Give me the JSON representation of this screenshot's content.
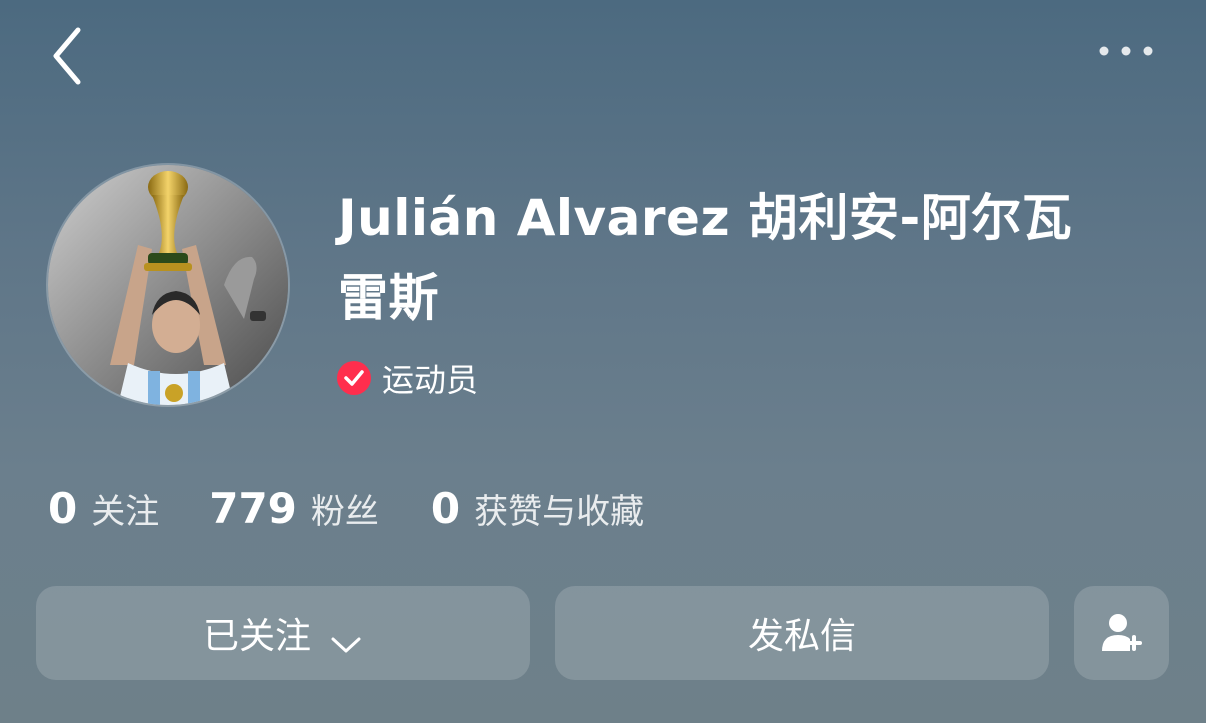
{
  "header": {
    "back_icon": "chevron-left-icon",
    "more_icon": "more-horizontal-icon"
  },
  "profile": {
    "name_line1": "Julián Alvarez 胡利安-阿尔瓦",
    "name_line2": "雷斯",
    "verification": {
      "label": "运动员",
      "icon": "verified-check-icon",
      "color": "#ff2e4d"
    },
    "avatar": "avatar"
  },
  "stats": [
    {
      "value": "0",
      "label": "关注"
    },
    {
      "value": "779",
      "label": "粉丝"
    },
    {
      "value": "0",
      "label": "获赞与收藏"
    }
  ],
  "actions": {
    "follow_label": "已关注",
    "follow_icon": "chevron-down-icon",
    "message_label": "发私信",
    "add_friend_icon": "add-user-icon"
  }
}
